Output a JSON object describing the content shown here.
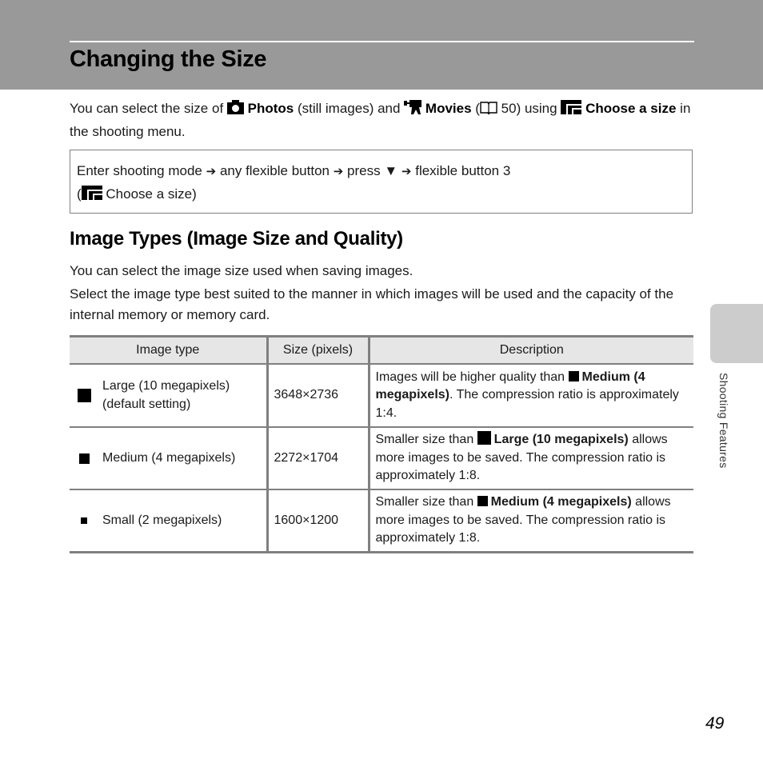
{
  "header": {
    "title": "Changing the Size"
  },
  "intro": {
    "t1": "You can select the size of ",
    "photos_icon": "camera-icon",
    "photos_label": "Photos",
    "t2": " (still images) and ",
    "movies_icon": "movie-camera-icon",
    "movies_label": "Movies",
    "t3": " (",
    "book_icon": "book-icon",
    "page_ref": " 50) using ",
    "choose_icon": "image-size-icon",
    "choose_label": "Choose a size",
    "t4": " in the shooting menu."
  },
  "procedure": {
    "step1": "Enter shooting mode",
    "step2": "any flexible button",
    "step3": "press",
    "step4": "flexible button 3",
    "arrow": "➔",
    "down_triangle": "▼",
    "paren_open": "(",
    "choose_label": "Choose a size",
    "paren_close": ")"
  },
  "section": {
    "title": "Image Types (Image Size and Quality)",
    "para1": "You can select the image size used when saving images.",
    "para2": "Select the image type best suited to the manner in which images will be used and the capacity of the internal memory or memory card."
  },
  "table": {
    "headers": [
      "Image type",
      "Size (pixels)",
      "Description"
    ],
    "rows": [
      {
        "icon": "large-size-icon",
        "type": "Large (10 megapixels) (default setting)",
        "size": "3648×2736",
        "desc_pre": "Images will be higher quality than ",
        "desc_ref": "Medium (4 megapixels)",
        "desc_post": ". The compression ratio is approximately 1:4."
      },
      {
        "icon": "medium-size-icon",
        "type": "Medium (4 megapixels)",
        "size": "2272×1704",
        "desc_pre": "Smaller size than ",
        "desc_ref": "Large (10 megapixels)",
        "desc_post": " allows more images to be saved. The compression ratio is approximately 1:8."
      },
      {
        "icon": "small-size-icon",
        "type": "Small (2 megapixels)",
        "size": "1600×1200",
        "desc_pre": "Smaller size than ",
        "desc_ref": "Medium (4 megapixels)",
        "desc_post": " allows more images to be saved. The compression ratio is approximately 1:8."
      }
    ]
  },
  "side_tab": {
    "label": "Shooting Features"
  },
  "page_number": "49",
  "colors": {
    "header_band": "#999999",
    "table_header_bg": "#e6e6e6",
    "rule": "#808080",
    "side_tab": "#cccccc"
  }
}
